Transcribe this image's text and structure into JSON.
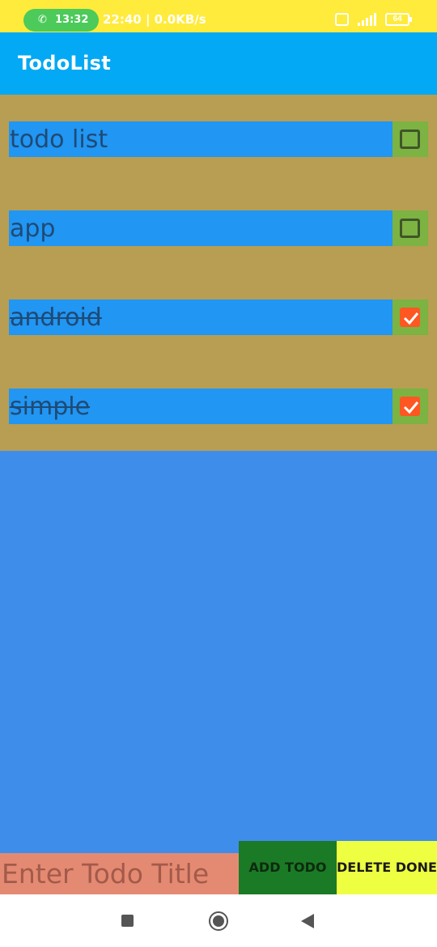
{
  "status_bar": {
    "call_time": "13:32",
    "clock_and_speed": "22:40 | 0.0KB/s",
    "battery_level": "64",
    "icons": [
      "phone-icon",
      "sim-icon",
      "signal-icon",
      "battery-icon"
    ]
  },
  "app_bar": {
    "title": "TodoList"
  },
  "todos": [
    {
      "title": "todo list",
      "done": false
    },
    {
      "title": "app",
      "done": false
    },
    {
      "title": "android",
      "done": true
    },
    {
      "title": "simple",
      "done": true
    }
  ],
  "bottom_bar": {
    "input_placeholder": "Enter Todo Title",
    "input_value": "",
    "add_label": "ADD TODO",
    "delete_label": "DELETE DONE"
  },
  "nav_bar": {
    "icons": [
      "recents-icon",
      "home-icon",
      "back-icon"
    ]
  },
  "colors": {
    "status_bar": "#ffeb3b",
    "app_bar": "#03a9f4",
    "list_background": "#b89e52",
    "item_background": "#2196f3",
    "checkbox_background": "#7cb342",
    "checked_color": "#ff5722",
    "empty_area": "#3f8dea",
    "input_background": "#e48a72",
    "add_button": "#1b7a25",
    "delete_button": "#eeff41"
  }
}
